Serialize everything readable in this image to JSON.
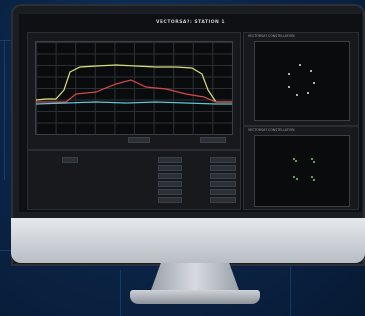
{
  "screen_title": "VECTORSA?: STATION 1",
  "colors": {
    "trace_yellow": "#d7e37a",
    "trace_red": "#d24a4a",
    "trace_cyan": "#5ec6d6",
    "constellation_white": "#e3e6ea",
    "constellation_green": "#7fc870"
  },
  "spectrum": {
    "trace_count": 3
  },
  "right_panels": [
    {
      "title": "VECTORSA? CONSTELLATION"
    },
    {
      "title": "VECTORSA? CONSTELLATION"
    }
  ],
  "controls": {
    "left_labels": [
      "",
      "",
      "",
      ""
    ],
    "mid_labels": [
      "",
      "",
      "",
      "",
      "",
      ""
    ],
    "right_labels": [
      "",
      "",
      "",
      "",
      "",
      ""
    ]
  }
}
